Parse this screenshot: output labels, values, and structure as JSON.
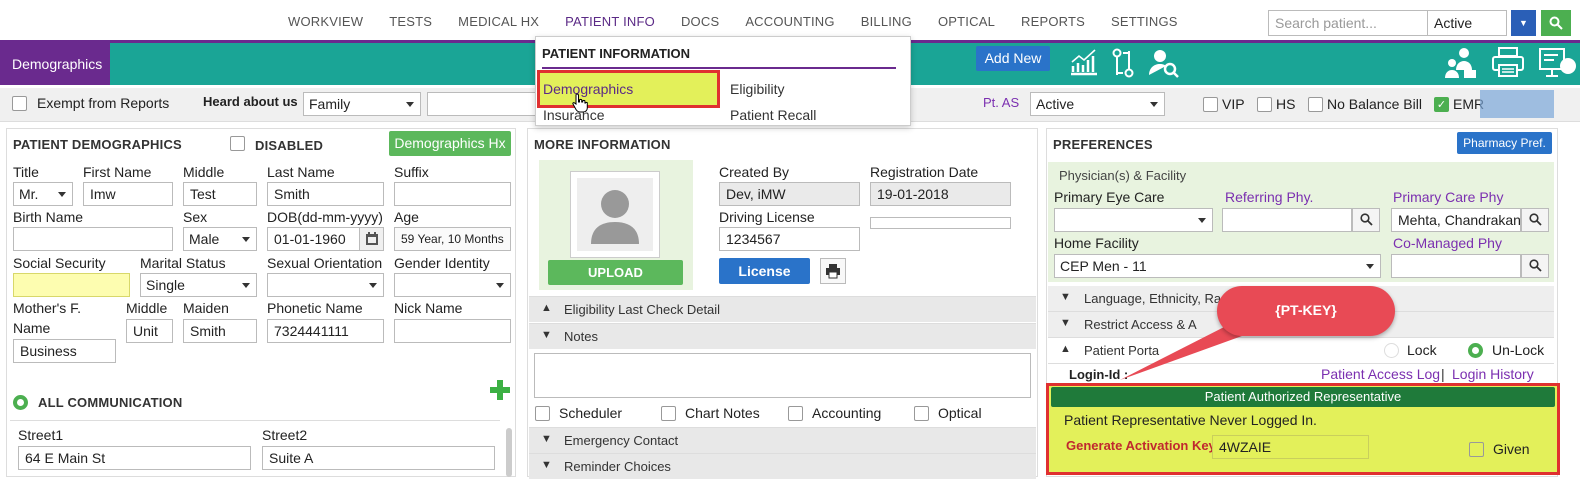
{
  "topnav": {
    "items": [
      "WORKVIEW",
      "TESTS",
      "MEDICAL HX",
      "PATIENT INFO",
      "DOCS",
      "ACCOUNTING",
      "BILLING",
      "OPTICAL",
      "REPORTS",
      "SETTINGS"
    ],
    "search_placeholder": "Search patient...",
    "status_value": "Active",
    "dropdown_btn": "▼",
    "search_btn": "🔍"
  },
  "header": {
    "tab": "Demographics",
    "add_new": "Add New"
  },
  "dropdown": {
    "title": "PATIENT INFORMATION",
    "col1": [
      "Demographics",
      "Insurance"
    ],
    "col2": [
      "Eligibility",
      "Patient Recall"
    ]
  },
  "subbar": {
    "exempt": "Exempt from Reports",
    "heard_label": "Heard about us",
    "heard_value": "Family",
    "pt_as_label": "Pt. AS",
    "pt_as_value": "Active",
    "vip": "VIP",
    "hs": "HS",
    "no_balance": "No Balance Bill",
    "emr": "EMR"
  },
  "demographics": {
    "title": "PATIENT DEMOGRAPHICS",
    "disabled": "DISABLED",
    "hx_btn": "Demographics Hx",
    "labels": {
      "title": "Title",
      "first": "First Name",
      "middle": "Middle",
      "last": "Last Name",
      "suffix": "Suffix",
      "birth_name": "Birth Name",
      "sex": "Sex",
      "dob": "DOB(dd-mm-yyyy)",
      "age": "Age",
      "ssn": "Social Security",
      "marital": "Marital Status",
      "orientation": "Sexual Orientation",
      "gender": "Gender Identity",
      "mother_f": "Mother's F.",
      "mother_name": "Name",
      "mother_middle": "Middle",
      "maiden": "Maiden",
      "phonetic": "Phonetic Name",
      "nick": "Nick Name"
    },
    "values": {
      "title": "Mr.",
      "first": "Imw",
      "middle": "Test",
      "last": "Smith",
      "sex": "Male",
      "dob": "01-01-1960",
      "age": "59 Year, 10 Months",
      "marital": "Single",
      "mother_name": "Business",
      "mother_middle": "Unit",
      "maiden": "Smith",
      "phonetic": "7324441111"
    },
    "communication": "ALL COMMUNICATION",
    "street1_label": "Street1",
    "street2_label": "Street2",
    "street1": "64 E Main St",
    "street2": "Suite A"
  },
  "more": {
    "title": "MORE INFORMATION",
    "upload": "UPLOAD",
    "created_by_label": "Created By",
    "created_by": "Dev, iMW",
    "reg_date_label": "Registration Date",
    "reg_date": "19-01-2018",
    "dl_label": "Driving License",
    "dl": "1234567",
    "license_btn": "License",
    "sections": [
      "Eligibility Last Check Detail",
      "Notes",
      "Emergency Contact",
      "Reminder Choices"
    ],
    "checks": [
      "Scheduler",
      "Chart Notes",
      "Accounting",
      "Optical"
    ]
  },
  "prefs": {
    "title": "PREFERENCES",
    "pharmacy_btn": "Pharmacy Pref.",
    "physician_section": "Physician(s) & Facility",
    "primary_eye": "Primary Eye Care",
    "referring": "Referring Phy.",
    "primary_care": "Primary Care Phy",
    "primary_care_value": "Mehta, Chandrakan",
    "home_facility": "Home Facility",
    "home_facility_value": "CEP Men - 11",
    "co_managed": "Co-Managed Phy",
    "rows": [
      "Language, Ethnicity, Rac",
      "Restrict Access & A",
      "Patient Porta"
    ],
    "lock": "Lock",
    "unlock": "Un-Lock",
    "login_id": "Login-Id :",
    "access_log": "Patient Access Log",
    "sep": "|",
    "login_history": "Login History",
    "auth_rep": "Patient Authorized Representative",
    "never_logged": "Patient Representative Never Logged In.",
    "gen_key": "Generate Activation Key",
    "key_value": "4WZAIE",
    "given": "Given"
  },
  "callout": {
    "text": "{PT-KEY}"
  },
  "colors": {
    "purple": "#6a2a8e",
    "teal": "#1aa596",
    "highlight": "#e3f05a",
    "callout": "#e84a55",
    "red_outline": "#e03030"
  }
}
